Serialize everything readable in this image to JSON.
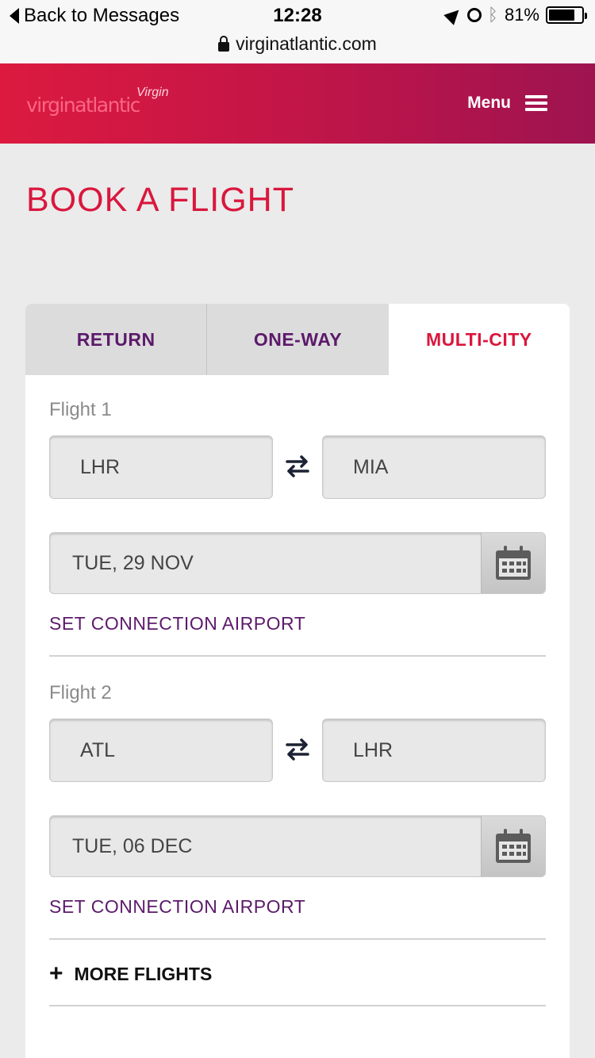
{
  "status_bar": {
    "back_label": "Back to Messages",
    "time": "12:28",
    "battery": "81%",
    "battery_level": 0.81,
    "url": "virginatlantic.com",
    "icons": [
      "location-arrow-icon",
      "alarm-icon",
      "bluetooth-icon",
      "battery-icon",
      "lock-icon"
    ]
  },
  "header": {
    "logo_text": "virginatlantic",
    "logo_signature": "Virgin",
    "menu_label": "Menu",
    "colors": {
      "gradient_start": "#dc1a3f",
      "gradient_end": "#9e1450"
    }
  },
  "page": {
    "title": "BOOK A FLIGHT",
    "accent_color": "#d9173d",
    "link_color": "#5c1a6b"
  },
  "tabs": [
    {
      "label": "RETURN",
      "active": false
    },
    {
      "label": "ONE-WAY",
      "active": false
    },
    {
      "label": "MULTI-CITY",
      "active": true
    }
  ],
  "flights": [
    {
      "label": "Flight 1",
      "origin": "LHR",
      "destination": "MIA",
      "date": "TUE, 29 NOV",
      "connection_link": "SET CONNECTION AIRPORT"
    },
    {
      "label": "Flight 2",
      "origin": "ATL",
      "destination": "LHR",
      "date": "TUE, 06 DEC",
      "connection_link": "SET CONNECTION AIRPORT"
    }
  ],
  "more_flights_label": "MORE FLIGHTS"
}
